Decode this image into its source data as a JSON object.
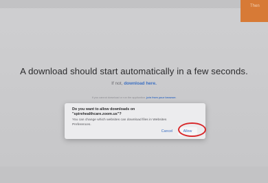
{
  "corner_button": {
    "label": "Then"
  },
  "headline": "A download should start automatically in a few seconds.",
  "subline": {
    "prefix": "If not,",
    "link": "download here."
  },
  "hint": {
    "prefix": "If you cannot download or run the application,",
    "link": "join from your browser."
  },
  "dialog": {
    "title": "Do you want to allow downloads on \"spirehealthcare.zoom.us\"?",
    "body": "You can change which websites can download files in Websites Preferences.",
    "cancel_label": "Cancel",
    "allow_label": "Allow"
  },
  "colors": {
    "accent_orange": "#d77a36",
    "link_blue": "#3b6fc2",
    "highlight_red": "#d8272a"
  }
}
